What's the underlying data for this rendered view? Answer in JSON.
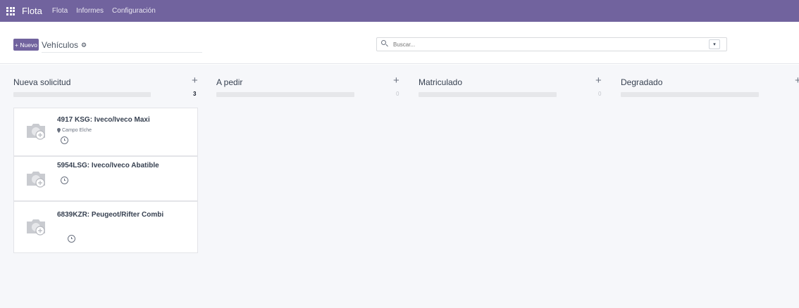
{
  "navbar": {
    "app_name": "Flota",
    "menu": [
      "Flota",
      "Informes",
      "Configuración"
    ],
    "apps_icon": "grid-icon",
    "color": "#71639e"
  },
  "control": {
    "new_label": "+ Nuevo",
    "breadcrumb": "Vehículos",
    "gear_icon": "gear-icon",
    "search_placeholder": "Buscar...",
    "search_toggle_icon": "caret-down-icon"
  },
  "columns": [
    {
      "title": "Nueva solicitud",
      "count": "3"
    },
    {
      "title": "A pedir",
      "count": "0"
    },
    {
      "title": "Matriculado",
      "count": "0"
    },
    {
      "title": "Degradado",
      "count": ""
    }
  ],
  "cards": [
    {
      "title": "4917 KSG: Iveco/Iveco Maxi",
      "location": "Campo Elche"
    },
    {
      "title": "5954LSG: Iveco/Iveco Abatible"
    },
    {
      "title": "6839KZR: Peugeot/Rifter Combi"
    }
  ]
}
